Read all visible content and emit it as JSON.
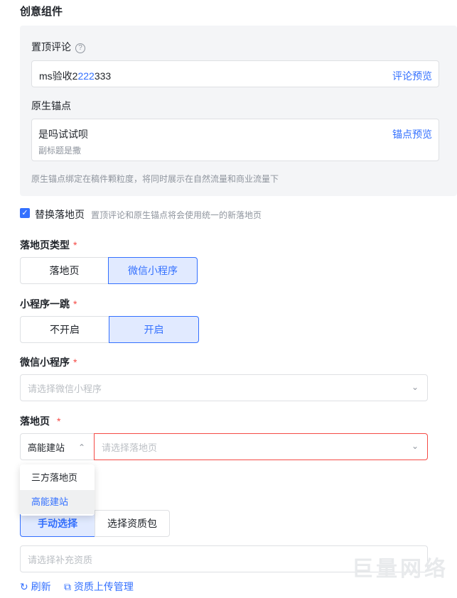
{
  "section_title": "创意组件",
  "pinned_comment": {
    "label": "置顶评论",
    "help_icon": "?",
    "value_prefix": "ms验收2",
    "value_highlight": "222",
    "value_suffix": "333",
    "preview_link": "评论预览"
  },
  "native_anchor": {
    "label": "原生锚点",
    "title": "是吗试试呗",
    "subtitle": "副标题是撒",
    "preview_link": "锚点预览",
    "note": "原生锚点绑定在稿件颗粒度，将同时展示在自然流量和商业流量下"
  },
  "replace_landing": {
    "checked": true,
    "check_glyph": "✓",
    "label": "替换落地页",
    "desc": "置顶评论和原生锚点将会使用统一的新落地页"
  },
  "landing_type": {
    "title": "落地页类型",
    "required": "*",
    "options": [
      "落地页",
      "微信小程序"
    ],
    "selected": "微信小程序"
  },
  "mini_jump": {
    "title": "小程序一跳",
    "required": "*",
    "options": [
      "不开启",
      "开启"
    ],
    "selected": "开启"
  },
  "wechat_mini": {
    "title": "微信小程序",
    "required": "*",
    "placeholder": "请选择微信小程序",
    "chevron": "⌄"
  },
  "landing_page": {
    "title": "落地页",
    "required": "*",
    "source_value": "高能建站",
    "source_chevron": "⌃",
    "placeholder": "请选择落地页",
    "chevron": "⌄",
    "dropdown_options": [
      "三方落地页",
      "高能建站"
    ],
    "dropdown_selected": "高能建站"
  },
  "qualification": {
    "buttons": [
      "手动选择",
      "选择资质包"
    ],
    "selected": "手动选择",
    "placeholder": "请选择补充资质",
    "refresh_icon": "↻",
    "refresh_label": "刷新",
    "upload_icon": "⧉",
    "upload_label": "资质上传管理"
  },
  "watermark": "巨量网络",
  "colors": {
    "accent": "#3370ff",
    "error": "#f54a45",
    "panel_bg": "#f4f5f7"
  }
}
